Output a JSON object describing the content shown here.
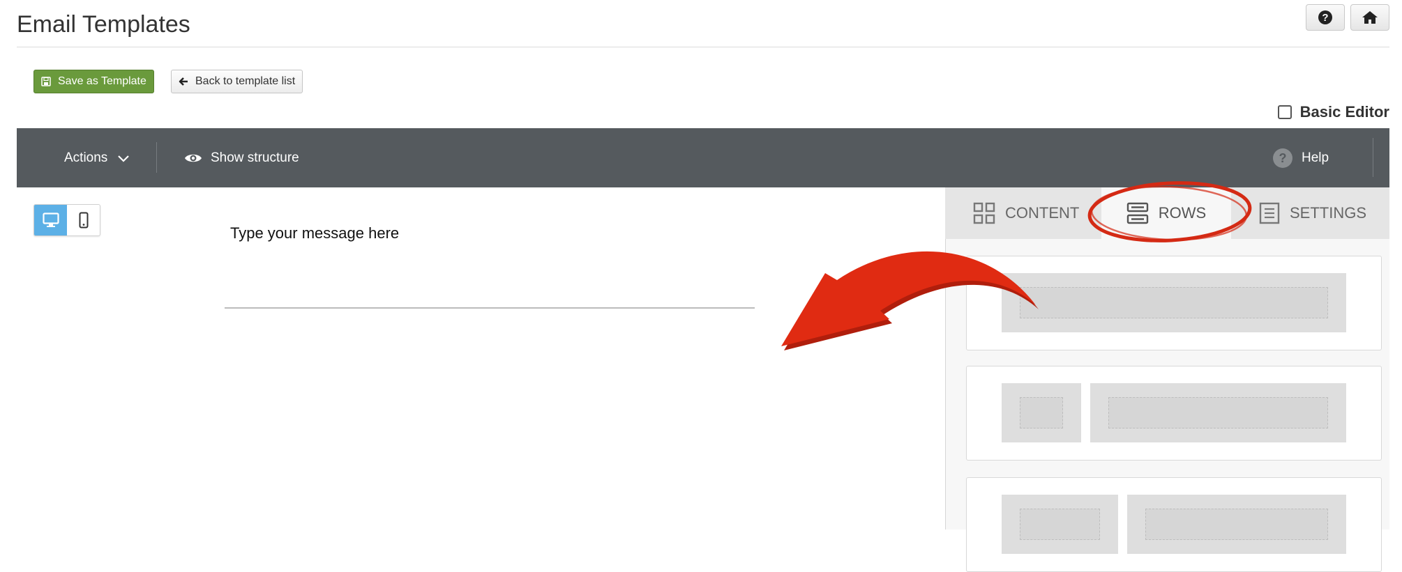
{
  "header": {
    "title": "Email Templates",
    "help_icon": "question-circle-icon",
    "home_icon": "home-icon"
  },
  "actions": {
    "save_label": "Save as Template",
    "back_label": "Back to template list",
    "basic_editor_label": "Basic Editor",
    "basic_editor_checked": false
  },
  "toolbar": {
    "actions_label": "Actions",
    "structure_label": "Show structure",
    "help_label": "Help"
  },
  "device": {
    "active": "desktop"
  },
  "canvas": {
    "message": "Type your message here"
  },
  "panel": {
    "tabs": [
      {
        "label": "CONTENT",
        "icon": "grid-icon"
      },
      {
        "label": "ROWS",
        "icon": "rows-icon",
        "active": true
      },
      {
        "label": "SETTINGS",
        "icon": "settings-list-icon"
      }
    ],
    "row_layouts": [
      "one-column",
      "two-column-1-3",
      "two-column-1-2"
    ]
  },
  "colors": {
    "save_green": "#6a9a3c",
    "toolbar_gray": "#555a5e",
    "device_active_blue": "#5cb0e6",
    "annotation_red": "#d42a14"
  }
}
